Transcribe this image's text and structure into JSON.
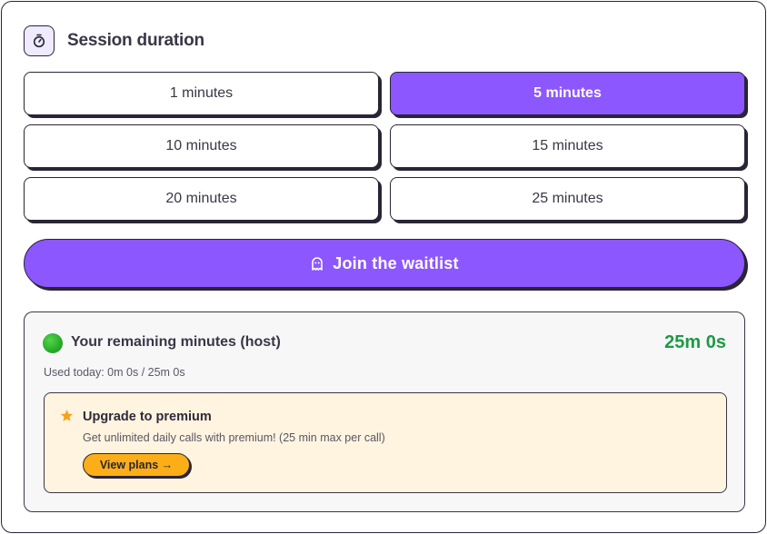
{
  "header": {
    "title": "Session duration",
    "icon": "stopwatch-icon"
  },
  "durations": [
    {
      "label": "1 minutes",
      "selected": false
    },
    {
      "label": "5 minutes",
      "selected": true
    },
    {
      "label": "10 minutes",
      "selected": false
    },
    {
      "label": "15 minutes",
      "selected": false
    },
    {
      "label": "20 minutes",
      "selected": false
    },
    {
      "label": "25 minutes",
      "selected": false
    }
  ],
  "waitlist": {
    "label": "Join the waitlist",
    "icon": "ghost-icon"
  },
  "remaining": {
    "label": "Your remaining minutes (host)",
    "value": "25m 0s",
    "used_today": "Used today: 0m 0s / 25m 0s",
    "status_color": "#2cae2c"
  },
  "upgrade": {
    "title": "Upgrade to premium",
    "description": "Get unlimited daily calls with premium! (25 min max per call)",
    "button_label": "View plans →",
    "icon": "star-icon"
  },
  "colors": {
    "accent": "#8c57ff",
    "success": "#1e9a44",
    "upgrade_bg": "#fef4e0",
    "upgrade_button": "#fbae17",
    "border": "#2a2536"
  }
}
